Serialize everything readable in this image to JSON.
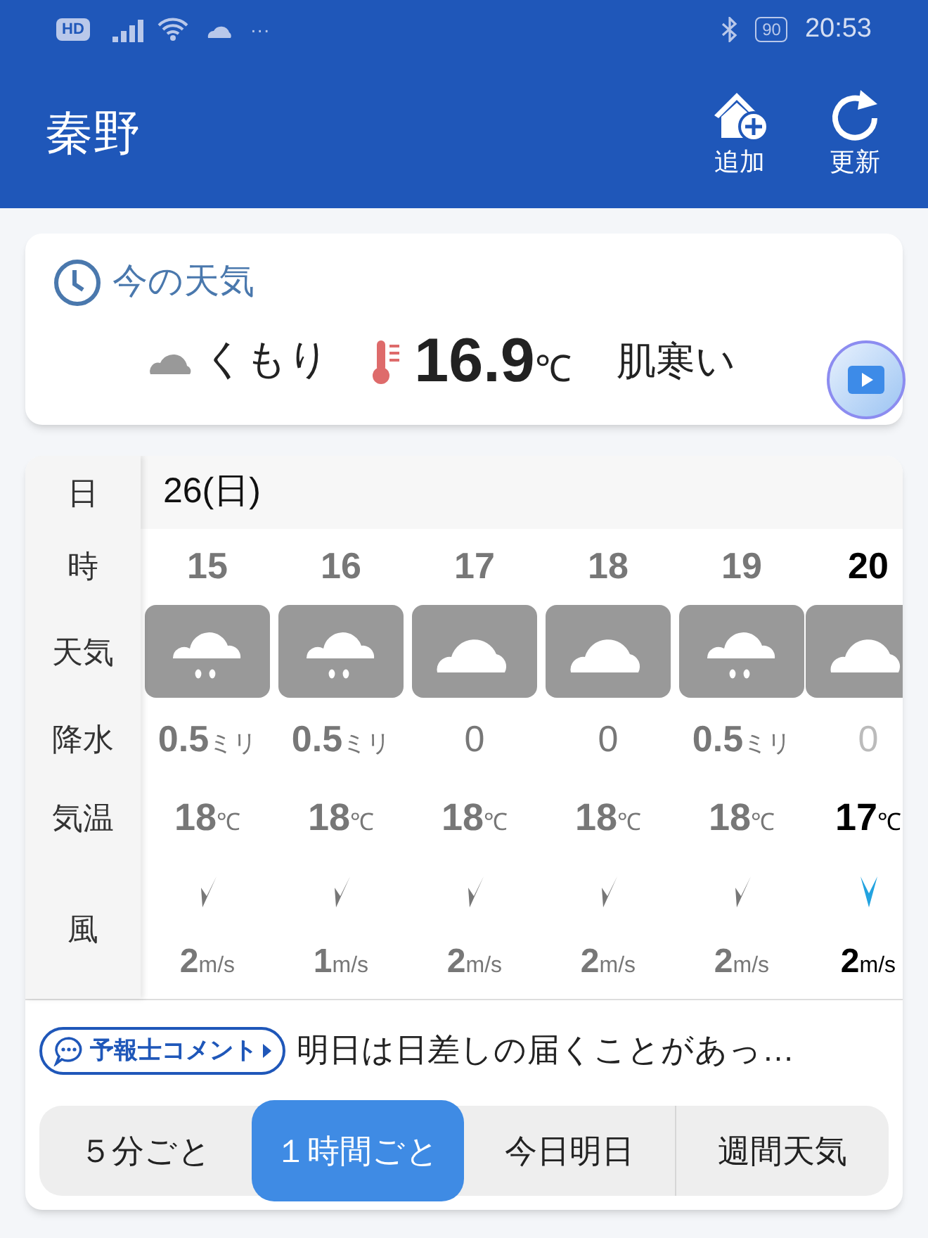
{
  "status_bar": {
    "network_badge": "HD",
    "more": "···",
    "battery": "90",
    "time": "20:53"
  },
  "header": {
    "title": "秦野",
    "actions": [
      {
        "kind": "add",
        "label": "追加"
      },
      {
        "kind": "refresh",
        "label": "更新"
      }
    ]
  },
  "current": {
    "heading": "今の天気",
    "condition": "くもり",
    "temperature": "16.9",
    "temp_unit": "℃",
    "feeling": "肌寒い"
  },
  "hourly": {
    "labels": {
      "date": "日",
      "hour": "時",
      "weather": "天気",
      "precip": "降水",
      "temp": "気温",
      "wind": "風"
    },
    "date": "26(日)",
    "columns": [
      {
        "hour": "15",
        "kind": "rain",
        "precip": "0.5",
        "precip_unit": "ミリ",
        "temp": "18",
        "temp_unit": "℃",
        "wind": "2",
        "wind_unit": "m/s",
        "current": false
      },
      {
        "hour": "16",
        "kind": "rain",
        "precip": "0.5",
        "precip_unit": "ミリ",
        "temp": "18",
        "temp_unit": "℃",
        "wind": "1",
        "wind_unit": "m/s",
        "current": false
      },
      {
        "hour": "17",
        "kind": "cloud",
        "precip": "0",
        "temp": "18",
        "temp_unit": "℃",
        "wind": "2",
        "wind_unit": "m/s",
        "current": false
      },
      {
        "hour": "18",
        "kind": "cloud",
        "precip": "0",
        "temp": "18",
        "temp_unit": "℃",
        "wind": "2",
        "wind_unit": "m/s",
        "current": false
      },
      {
        "hour": "19",
        "kind": "rain",
        "precip": "0.5",
        "precip_unit": "ミリ",
        "temp": "18",
        "temp_unit": "℃",
        "wind": "2",
        "wind_unit": "m/s",
        "current": false
      },
      {
        "hour": "20",
        "kind": "cloud",
        "precip": "0",
        "temp": "17",
        "temp_unit": "℃",
        "wind": "2",
        "wind_unit": "m/s",
        "current": true
      }
    ]
  },
  "comment": {
    "badge": "予報士コメント",
    "text": "明日は日差しの届くことがあっ…"
  },
  "tabs": [
    {
      "label": "５分ごと",
      "selected": false
    },
    {
      "label": "１時間ごと",
      "selected": true
    },
    {
      "label": "今日明日",
      "selected": false
    },
    {
      "label": "週間天気",
      "selected": false
    }
  ]
}
